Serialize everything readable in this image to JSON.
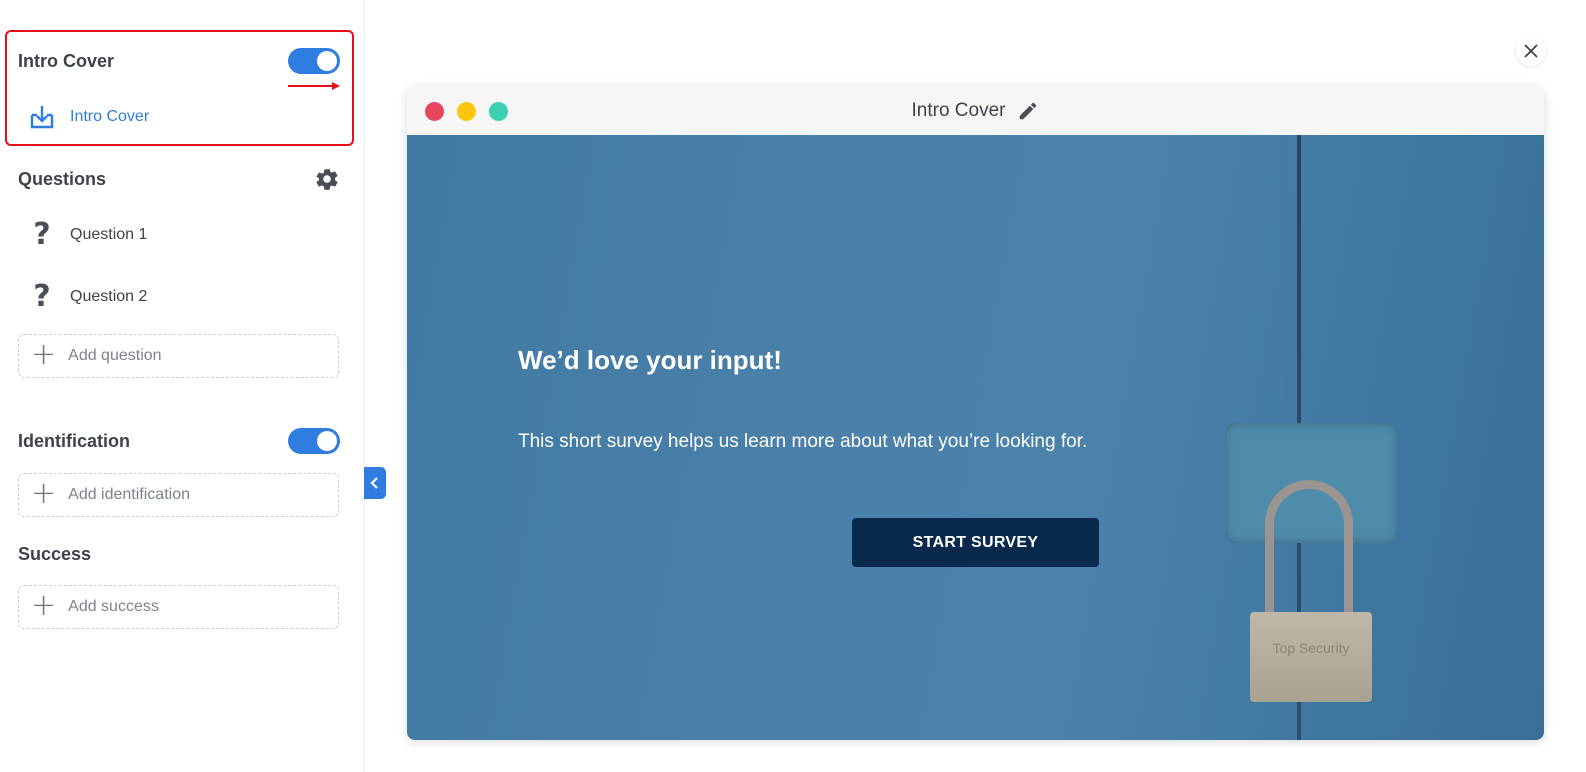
{
  "sidebar": {
    "intro": {
      "title": "Intro Cover",
      "toggle_on": true,
      "item_label": "Intro Cover"
    },
    "questions": {
      "title": "Questions",
      "items": [
        {
          "label": "Question 1"
        },
        {
          "label": "Question 2"
        }
      ],
      "add_label": "Add question"
    },
    "identification": {
      "title": "Identification",
      "toggle_on": true,
      "add_label": "Add identification"
    },
    "success": {
      "title": "Success",
      "add_label": "Add success"
    }
  },
  "preview": {
    "window_title": "Intro Cover",
    "headline": "We’d love your input!",
    "subtext": "This short survey helps us learn more about what you’re looking for.",
    "button_label": "START SURVEY",
    "lock_text": "Top Security"
  },
  "colors": {
    "accent": "#2f7de1",
    "highlight": "#e4101b",
    "dot_red": "#e5475e",
    "dot_yellow": "#fdc60e",
    "dot_green": "#3ccfb4",
    "button": "#0a2a4d"
  },
  "icons": {
    "download": "download-tray-icon",
    "question": "question-mark-icon",
    "gear": "gear-icon",
    "plus": "plus-icon",
    "close": "close-icon",
    "pencil": "pencil-icon",
    "chevron": "chevron-left-icon"
  }
}
